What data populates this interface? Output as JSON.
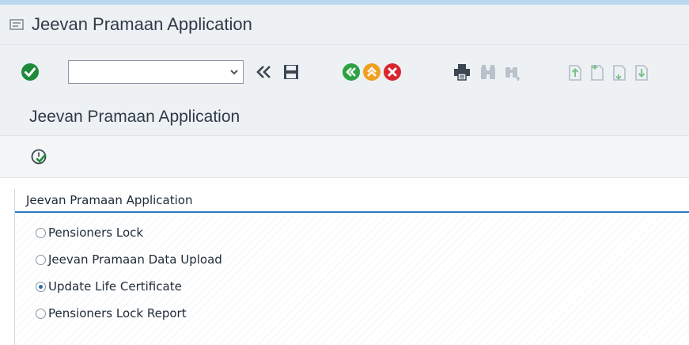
{
  "window": {
    "title": "Jeevan Pramaan Application"
  },
  "toolbar": {
    "command_field": {
      "value": ""
    },
    "icons": [
      "enter-icon",
      "dropdown-icon",
      "back-double-icon",
      "save-icon",
      "back-icon",
      "exit-icon",
      "cancel-icon",
      "print-icon",
      "find-icon",
      "find-next-icon",
      "first-page-icon",
      "previous-page-icon",
      "next-page-icon",
      "last-page-icon"
    ]
  },
  "page": {
    "title": "Jeevan Pramaan Application"
  },
  "appbar": {
    "execute_icon": "execute-icon"
  },
  "group": {
    "title": "Jeevan Pramaan Application",
    "options": [
      {
        "label": "Pensioners Lock",
        "selected": false
      },
      {
        "label": "Jeevan Pramaan Data Upload",
        "selected": false
      },
      {
        "label": "Update Life Certificate",
        "selected": true
      },
      {
        "label": "Pensioners Lock Report",
        "selected": false
      }
    ]
  },
  "colors": {
    "accent_blue": "#2a7cbf",
    "enter_green": "#1e8a3a",
    "back_green": "#2ea043",
    "exit_orange": "#f0a020",
    "cancel_red": "#d9262e"
  }
}
